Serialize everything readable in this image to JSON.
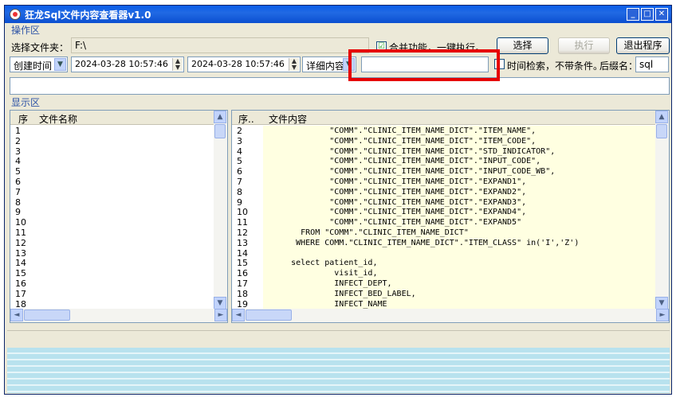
{
  "window": {
    "title": "狂龙Sql文件内容查看器v1.0"
  },
  "ops": {
    "group_label": "操作区",
    "folder_label": "选择文件夹：",
    "folder_value": "F:\\",
    "merge_check": "☑",
    "merge_label": "合并功能，一键执行。",
    "choose_btn": "选择",
    "exec_btn": "执行",
    "exit_btn": "退出程序",
    "sort_field": "创建时间",
    "date_from": "2024-03-28 10:57:46",
    "date_to": "2024-03-28 10:57:46",
    "detail_field": "详细内容",
    "search_value": "",
    "time_search_label": "时间检索，不带条件。",
    "suffix_label": "后缀名：",
    "suffix_value": "sql",
    "path_value": ""
  },
  "display": {
    "group_label": "显示区",
    "left_header": {
      "seq": "序",
      "name": "文件名称"
    },
    "left_rows": [
      "1",
      "2",
      "3",
      "4",
      "5",
      "6",
      "7",
      "8",
      "9",
      "10",
      "11",
      "12",
      "13",
      "14",
      "15",
      "16",
      "17",
      "18"
    ],
    "right_header": {
      "seq": "序..",
      "content": "文件内容"
    },
    "code_lines": [
      {
        "n": "2",
        "t": "             \"COMM\".\"CLINIC_ITEM_NAME_DICT\".\"ITEM_NAME\","
      },
      {
        "n": "3",
        "t": "             \"COMM\".\"CLINIC_ITEM_NAME_DICT\".\"ITEM_CODE\","
      },
      {
        "n": "4",
        "t": "             \"COMM\".\"CLINIC_ITEM_NAME_DICT\".\"STD_INDICATOR\","
      },
      {
        "n": "5",
        "t": "             \"COMM\".\"CLINIC_ITEM_NAME_DICT\".\"INPUT_CODE\","
      },
      {
        "n": "6",
        "t": "             \"COMM\".\"CLINIC_ITEM_NAME_DICT\".\"INPUT_CODE_WB\","
      },
      {
        "n": "7",
        "t": "             \"COMM\".\"CLINIC_ITEM_NAME_DICT\".\"EXPAND1\","
      },
      {
        "n": "8",
        "t": "             \"COMM\".\"CLINIC_ITEM_NAME_DICT\".\"EXPAND2\","
      },
      {
        "n": "9",
        "t": "             \"COMM\".\"CLINIC_ITEM_NAME_DICT\".\"EXPAND3\","
      },
      {
        "n": "10",
        "t": "             \"COMM\".\"CLINIC_ITEM_NAME_DICT\".\"EXPAND4\","
      },
      {
        "n": "11",
        "t": "             \"COMM\".\"CLINIC_ITEM_NAME_DICT\".\"EXPAND5\""
      },
      {
        "n": "12",
        "t": "       FROM \"COMM\".\"CLINIC_ITEM_NAME_DICT\""
      },
      {
        "n": "13",
        "t": "      WHERE COMM.\"CLINIC_ITEM_NAME_DICT\".\"ITEM_CLASS\" in('I','Z')"
      },
      {
        "n": "14",
        "t": ""
      },
      {
        "n": "15",
        "t": "     select patient_id,"
      },
      {
        "n": "16",
        "t": "              visit_id,"
      },
      {
        "n": "17",
        "t": "              INFECT_DEPT,"
      },
      {
        "n": "18",
        "t": "              INFECT_BED_LABEL,"
      },
      {
        "n": "19",
        "t": "              INFECT_NAME"
      }
    ]
  },
  "scroll": {
    "up": "▲",
    "down": "▼",
    "left": "◄",
    "right": "►"
  },
  "icons": {
    "spin_up_down": "▲▼",
    "dropdown": "▼"
  }
}
